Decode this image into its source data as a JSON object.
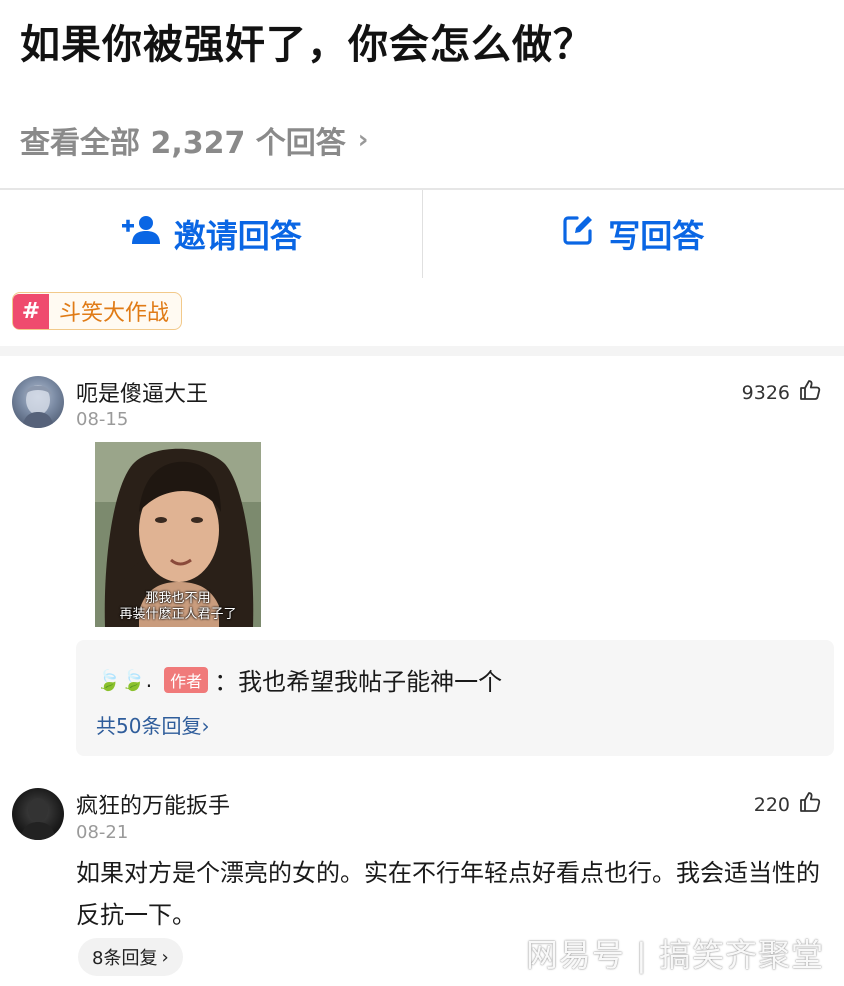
{
  "question": {
    "title": "如果你被强奸了，你会怎么做？",
    "view_all": "查看全部 2,327 个回答",
    "view_all_chevron": "›"
  },
  "actions": {
    "invite": "邀请回答",
    "write": "写回答",
    "accent_color": "#0a66e4"
  },
  "topic": {
    "hash": "#",
    "label": "斗笑大作战"
  },
  "answers": [
    {
      "username": "呃是傻逼大王",
      "date": "08-15",
      "likes": "9326",
      "image_subtitle_line1": "那我也不用",
      "image_subtitle_line2": "再装什麼正人君子了",
      "reply": {
        "leaves": "🍃🍃.",
        "badge": "作者",
        "text": "：我也希望我帖子能神一个",
        "count": "共50条回复",
        "chevron": "›"
      }
    },
    {
      "username": "疯狂的万能扳手",
      "date": "08-21",
      "likes": "220",
      "text": "如果对方是个漂亮的女的。实在不行年轻点好看点也行。我会适当性的反抗一下。",
      "replies": "8条回复",
      "replies_chevron": "›"
    }
  ],
  "watermark": "网易号 | 搞笑齐聚堂",
  "icons": {
    "invite": "add-person-icon",
    "write": "edit-icon",
    "like": "thumbs-up-icon"
  }
}
